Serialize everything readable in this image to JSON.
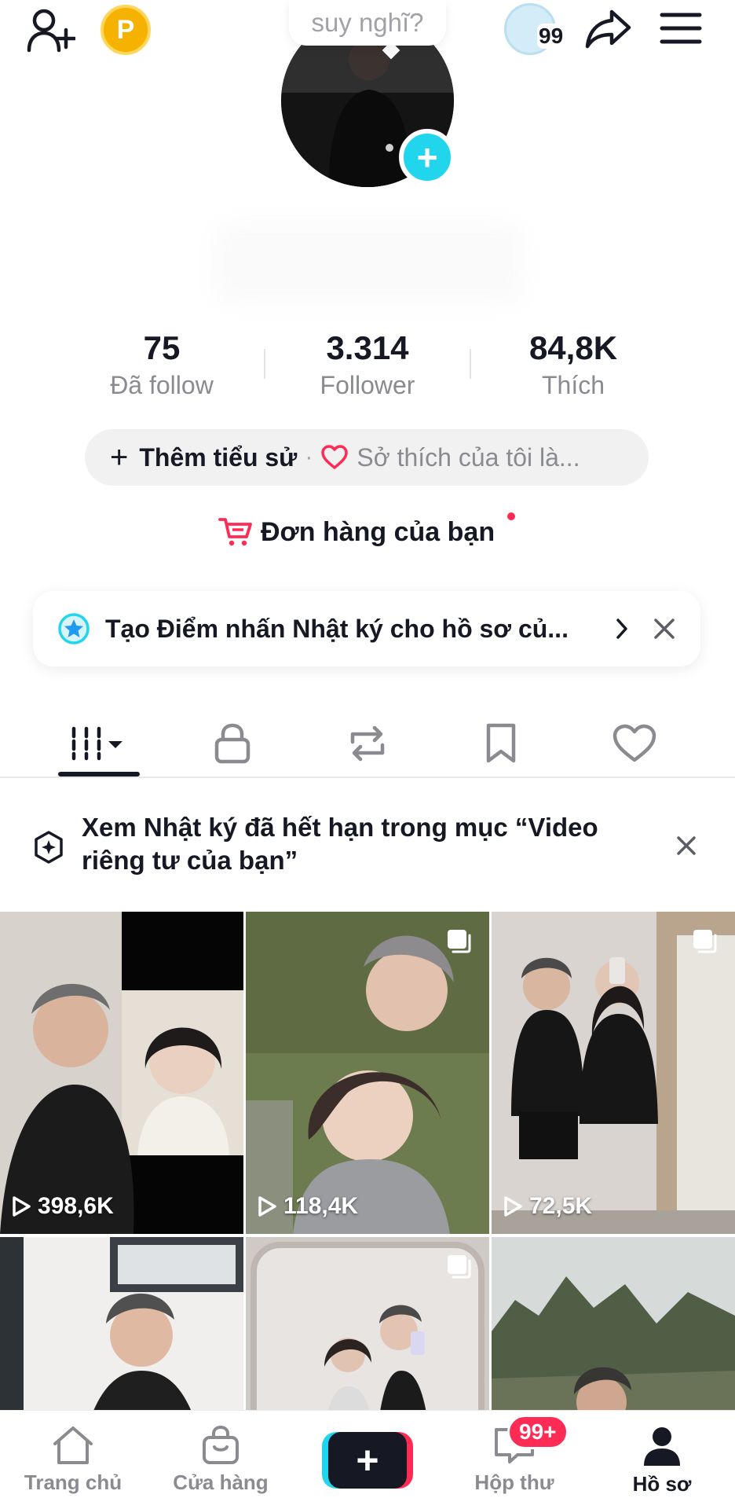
{
  "header": {
    "status_prompt": "suy nghĩ?",
    "coin_label": "P",
    "story_count": "99"
  },
  "stats": [
    {
      "value": "75",
      "label": "Đã follow"
    },
    {
      "value": "3.314",
      "label": "Follower"
    },
    {
      "value": "84,8K",
      "label": "Thích"
    }
  ],
  "bio": {
    "add_label": "Thêm tiểu sử",
    "separator": "·",
    "hobby_placeholder": "Sở thích của tôi là..."
  },
  "orders": {
    "label": "Đơn hàng của bạn"
  },
  "highlight_card": {
    "text": "Tạo Điểm nhấn Nhật ký cho hồ sơ củ..."
  },
  "expired_banner": {
    "text": "Xem Nhật ký đã hết hạn trong mục “Video riêng tư của bạn”"
  },
  "videos": [
    {
      "views": "398,6K"
    },
    {
      "views": "118,4K"
    },
    {
      "views": "72,5K"
    },
    {
      "views": ""
    },
    {
      "views": ""
    },
    {
      "views": ""
    }
  ],
  "bottom_nav": {
    "home": "Trang chủ",
    "shop": "Cửa hàng",
    "inbox": "Hộp thư",
    "inbox_badge": "99+",
    "profile": "Hồ sơ"
  },
  "colors": {
    "brand_pink": "#fe2c55",
    "brand_cyan": "#20d5ec",
    "text_primary": "#161823",
    "text_secondary": "#8a8b91"
  }
}
